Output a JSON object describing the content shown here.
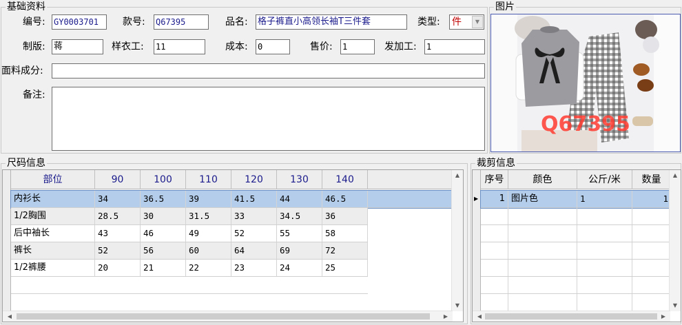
{
  "basic": {
    "title": "基础资料",
    "code_label": "编号:",
    "code_value": "GY0003701",
    "style_label": "款号:",
    "style_value": "Q67395",
    "name_label": "品名:",
    "name_value": "格子裤直小高领长袖T三件套",
    "type_label": "类型:",
    "type_value": "件",
    "pattern_label": "制版:",
    "pattern_value": "蒋",
    "sample_label": "样衣工:",
    "sample_value": "11",
    "cost_label": "成本:",
    "cost_value": "0",
    "price_label": "售价:",
    "price_value": "1",
    "outsource_label": "发加工:",
    "outsource_value": "1",
    "fabric_label": "面料成分:",
    "fabric_value": "",
    "remark_label": "备注:",
    "remark_value": ""
  },
  "picture": {
    "title": "图片",
    "watermark": "Q67395"
  },
  "size": {
    "title": "尺码信息",
    "columns": [
      "部位",
      "90",
      "100",
      "110",
      "120",
      "130",
      "140"
    ],
    "rows": [
      [
        "内衫长",
        "34",
        "36.5",
        "39",
        "41.5",
        "44",
        "46.5"
      ],
      [
        "1/2胸围",
        "28.5",
        "30",
        "31.5",
        "33",
        "34.5",
        "36"
      ],
      [
        "后中袖长",
        "43",
        "46",
        "49",
        "52",
        "55",
        "58"
      ],
      [
        "裤长",
        "52",
        "56",
        "60",
        "64",
        "69",
        "72"
      ],
      [
        "1/2裤腰",
        "20",
        "21",
        "22",
        "23",
        "24",
        "25"
      ]
    ]
  },
  "cut": {
    "title": "裁剪信息",
    "columns": [
      "序号",
      "颜色",
      "公斤/米",
      "数量"
    ],
    "rows": [
      [
        "1",
        "图片色",
        "1",
        "1"
      ]
    ]
  },
  "colors": {
    "selected_row": "#b4cdea",
    "alt_row": "#ededed",
    "header_text": "#1a1a8c",
    "type_text": "#c00000"
  }
}
